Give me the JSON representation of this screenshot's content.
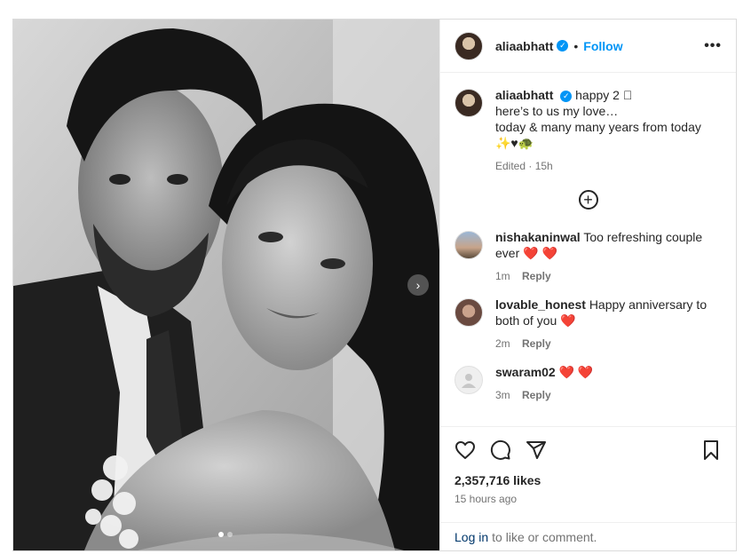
{
  "post": {
    "username": "aliaabhatt",
    "follow_label": "Follow",
    "separator": "•",
    "more_label": "•••",
    "verified_mark": "✓",
    "next_label": "›"
  },
  "caption": {
    "username": "aliaabhatt",
    "first_line": "happy 2 \u0000",
    "line2": "here’s to us my love…",
    "line3": "today & many many years from today",
    "line4": "✨♥🐢",
    "edited": "Edited · 15h"
  },
  "load_more_label": "+",
  "comments": [
    {
      "username": "nishakaninwal",
      "text": "Too refreshing couple ever",
      "emoji": "❤️ ❤️",
      "time": "1m",
      "reply": "Reply"
    },
    {
      "username": "lovable_honest",
      "text": "Happy anniversary to both of you",
      "emoji": "❤️",
      "time": "2m",
      "reply": "Reply"
    },
    {
      "username": "swaram02",
      "text": "",
      "emoji": "❤️ ❤️",
      "time": "3m",
      "reply": "Reply"
    }
  ],
  "stats": {
    "likes": "2,357,716 likes",
    "time_ago": "15 hours ago"
  },
  "login_bar": {
    "login": "Log in",
    "rest": "to like or comment."
  },
  "carousel": {
    "total": 2,
    "current": 1
  },
  "icons": [
    "heart-outline-icon",
    "comment-icon",
    "share-icon",
    "bookmark-icon",
    "more-icon",
    "plus-circle-icon",
    "chevron-right-icon",
    "verified-badge-icon"
  ],
  "colors": {
    "accent": "#0095f6",
    "link_dark": "#00376b",
    "muted": "#737373",
    "heart": "#e0245e"
  }
}
